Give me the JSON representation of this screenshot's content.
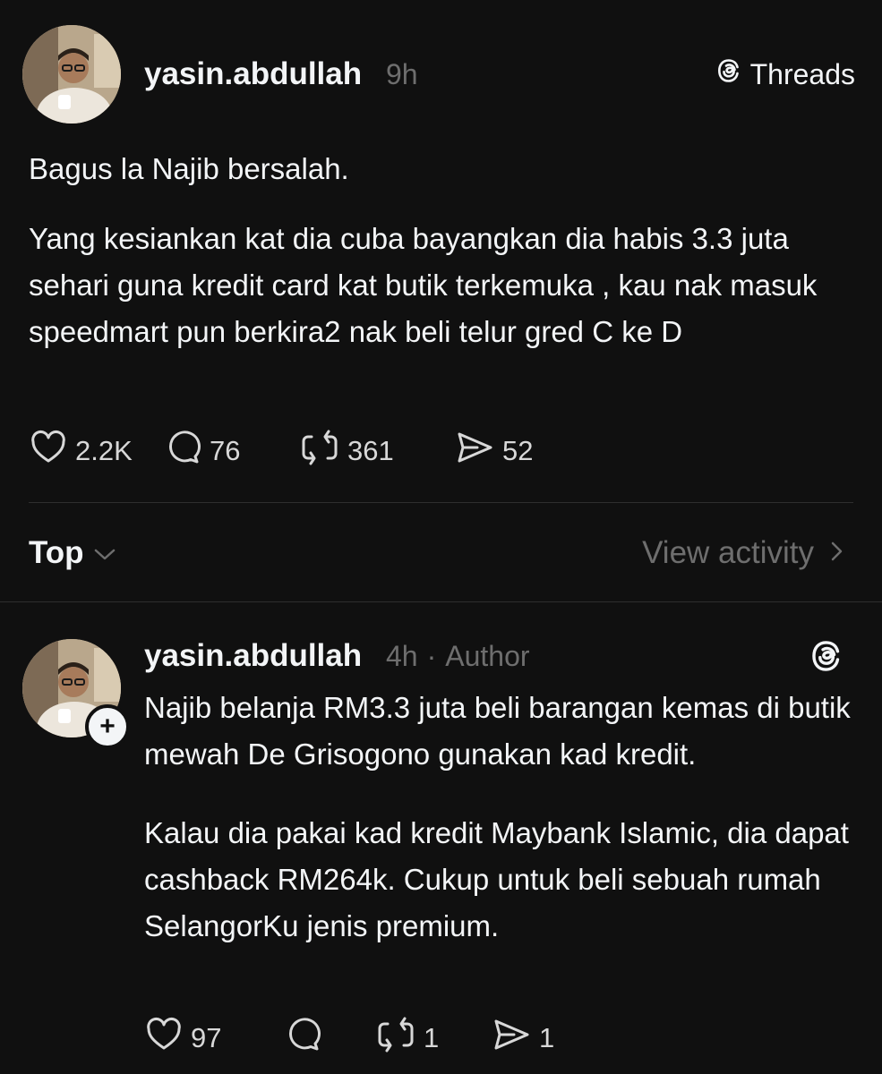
{
  "post": {
    "username": "yasin.abdullah",
    "time": "9h",
    "platform_label": "Threads",
    "paragraphs": [
      "Bagus la Najib bersalah.",
      "Yang kesiankan kat dia cuba bayangkan dia habis 3.3 juta sehari guna kredit card kat butik terkemuka , kau nak masuk speedmart pun berkira2 nak beli telur gred C ke D"
    ],
    "stats": {
      "likes": "2.2K",
      "replies": "76",
      "reposts": "361",
      "shares": "52"
    }
  },
  "sort_bar": {
    "sort_label": "Top",
    "activity_label": "View activity"
  },
  "reply": {
    "username": "yasin.abdullah",
    "time": "4h",
    "separator": "·",
    "role": "Author",
    "plus_label": "+",
    "paragraphs": [
      "Najib belanja RM3.3 juta beli barangan kemas di butik mewah De Grisogono gunakan kad kredit.",
      "Kalau dia pakai kad kredit Maybank Islamic, dia dapat cashback RM264k. Cukup untuk beli sebuah rumah SelangorKu jenis premium."
    ],
    "stats": {
      "likes": "97",
      "replies": "",
      "reposts": "1",
      "shares": "1"
    }
  },
  "colors": {
    "background": "#101010",
    "text": "#f3f5f7",
    "muted": "#6e6e6e",
    "divider": "#2e2e2e"
  }
}
